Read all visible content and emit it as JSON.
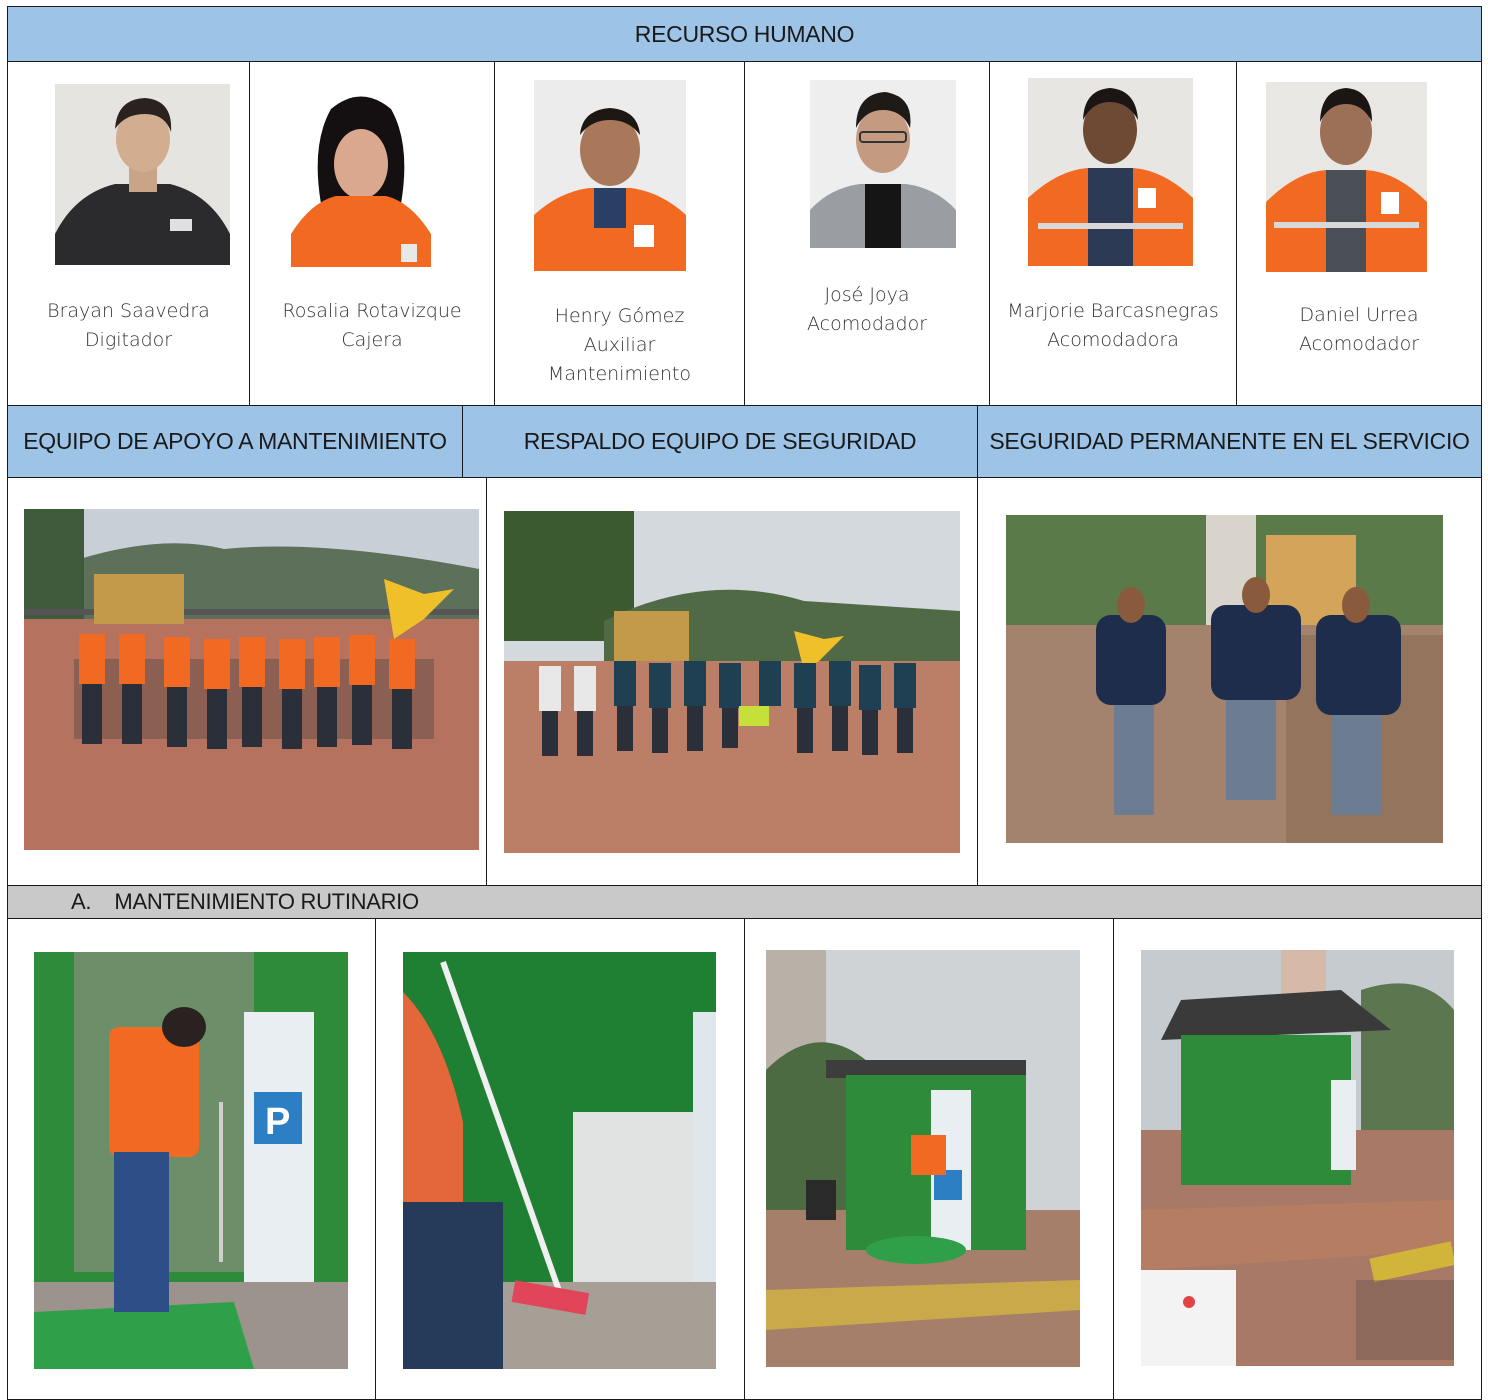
{
  "headers": {
    "human_resources": "RECURSO HUMANO",
    "maintenance_support": "EQUIPO DE APOYO A MANTENIMIENTO",
    "security_backup": "RESPALDO EQUIPO DE SEGURIDAD",
    "permanent_security": "SEGURIDAD PERMANENTE EN EL SERVICIO",
    "routine_maintenance": "A.    MANTENIMIENTO RUTINARIO"
  },
  "staff": [
    {
      "name": "Brayan Saavedra",
      "role": "Digitador",
      "role2": ""
    },
    {
      "name": "Rosalia Rotavizque",
      "role": "Cajera",
      "role2": ""
    },
    {
      "name": "Henry Gómez",
      "role": "Auxiliar",
      "role2": "Mantenimiento"
    },
    {
      "name": "José Joya",
      "role": "Acomodador",
      "role2": ""
    },
    {
      "name": "Marjorie Barcasnegras",
      "role": "Acomodadora",
      "role2": ""
    },
    {
      "name": "Daniel Urrea",
      "role": "Acomodador",
      "role2": ""
    }
  ],
  "colors": {
    "header_blue": "#9dc3e6",
    "header_gray": "#c9c9c9",
    "vest_orange": "#f26a21",
    "kiosk_green": "#2e8b3a",
    "security_navy": "#1f2d4d"
  }
}
